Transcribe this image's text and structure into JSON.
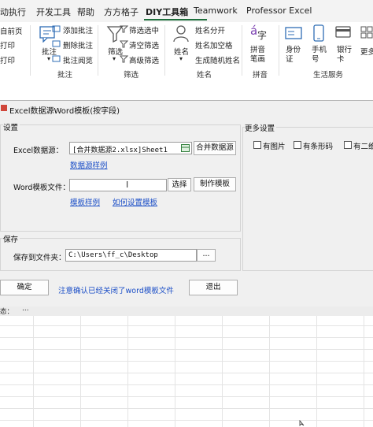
{
  "ribbon": {
    "tabs": [
      "动执行",
      "开发工具",
      "帮助",
      "方方格子",
      "DIY工具箱",
      "Teamwork",
      "Professor Excel"
    ],
    "col1": [
      "自前页",
      "打印",
      "打印"
    ],
    "annotate": {
      "big": "批注",
      "add": "添加批注",
      "delete": "删除批注",
      "browse": "批注阅览",
      "group": "批注"
    },
    "filter": {
      "big": "筛选",
      "filter_selected": "筛选选中",
      "clear": "清空筛选",
      "advanced": "高级筛选",
      "group": "筛选"
    },
    "name": {
      "big": "姓名",
      "split": "姓名分开",
      "add_space": "姓名加空格",
      "random": "生成随机姓名",
      "group": "姓名"
    },
    "pinyin": {
      "big": "拼音笔画",
      "group": "拼音"
    },
    "life": {
      "id": "身份证",
      "phone": "手机号",
      "bank": "银行卡",
      "more": "更多",
      "group": "生活服务"
    }
  },
  "dialog": {
    "title": "Excel数据源Word模板(按字段)",
    "settings_label": "设置",
    "excel_source_label": "Excel数据源：",
    "excel_source_value": "[合并数据源2.xlsx]Sheet1",
    "merge_button": "合并数据源",
    "source_example_link": "数据源样例",
    "word_template_label": "Word模板文件：",
    "word_template_value": "",
    "select_button": "选择",
    "make_template_button": "制作模板",
    "template_example_link": "模板样例",
    "how_to_set_link": "如何设置模板",
    "save_label": "保存",
    "save_to_label": "保存到文件夹：",
    "save_path": "C:\\Users\\ff_c\\Desktop",
    "browse_button": "...",
    "more_settings_label": "更多设置",
    "opt_image": "有图片",
    "opt_barcode": "有条形码",
    "opt_qr": "有二维",
    "ok_button": "确定",
    "notice": "注意确认已经关闭了word模板文件",
    "exit_button": "退出"
  },
  "status": {
    "label": "态：",
    "value": "..."
  }
}
